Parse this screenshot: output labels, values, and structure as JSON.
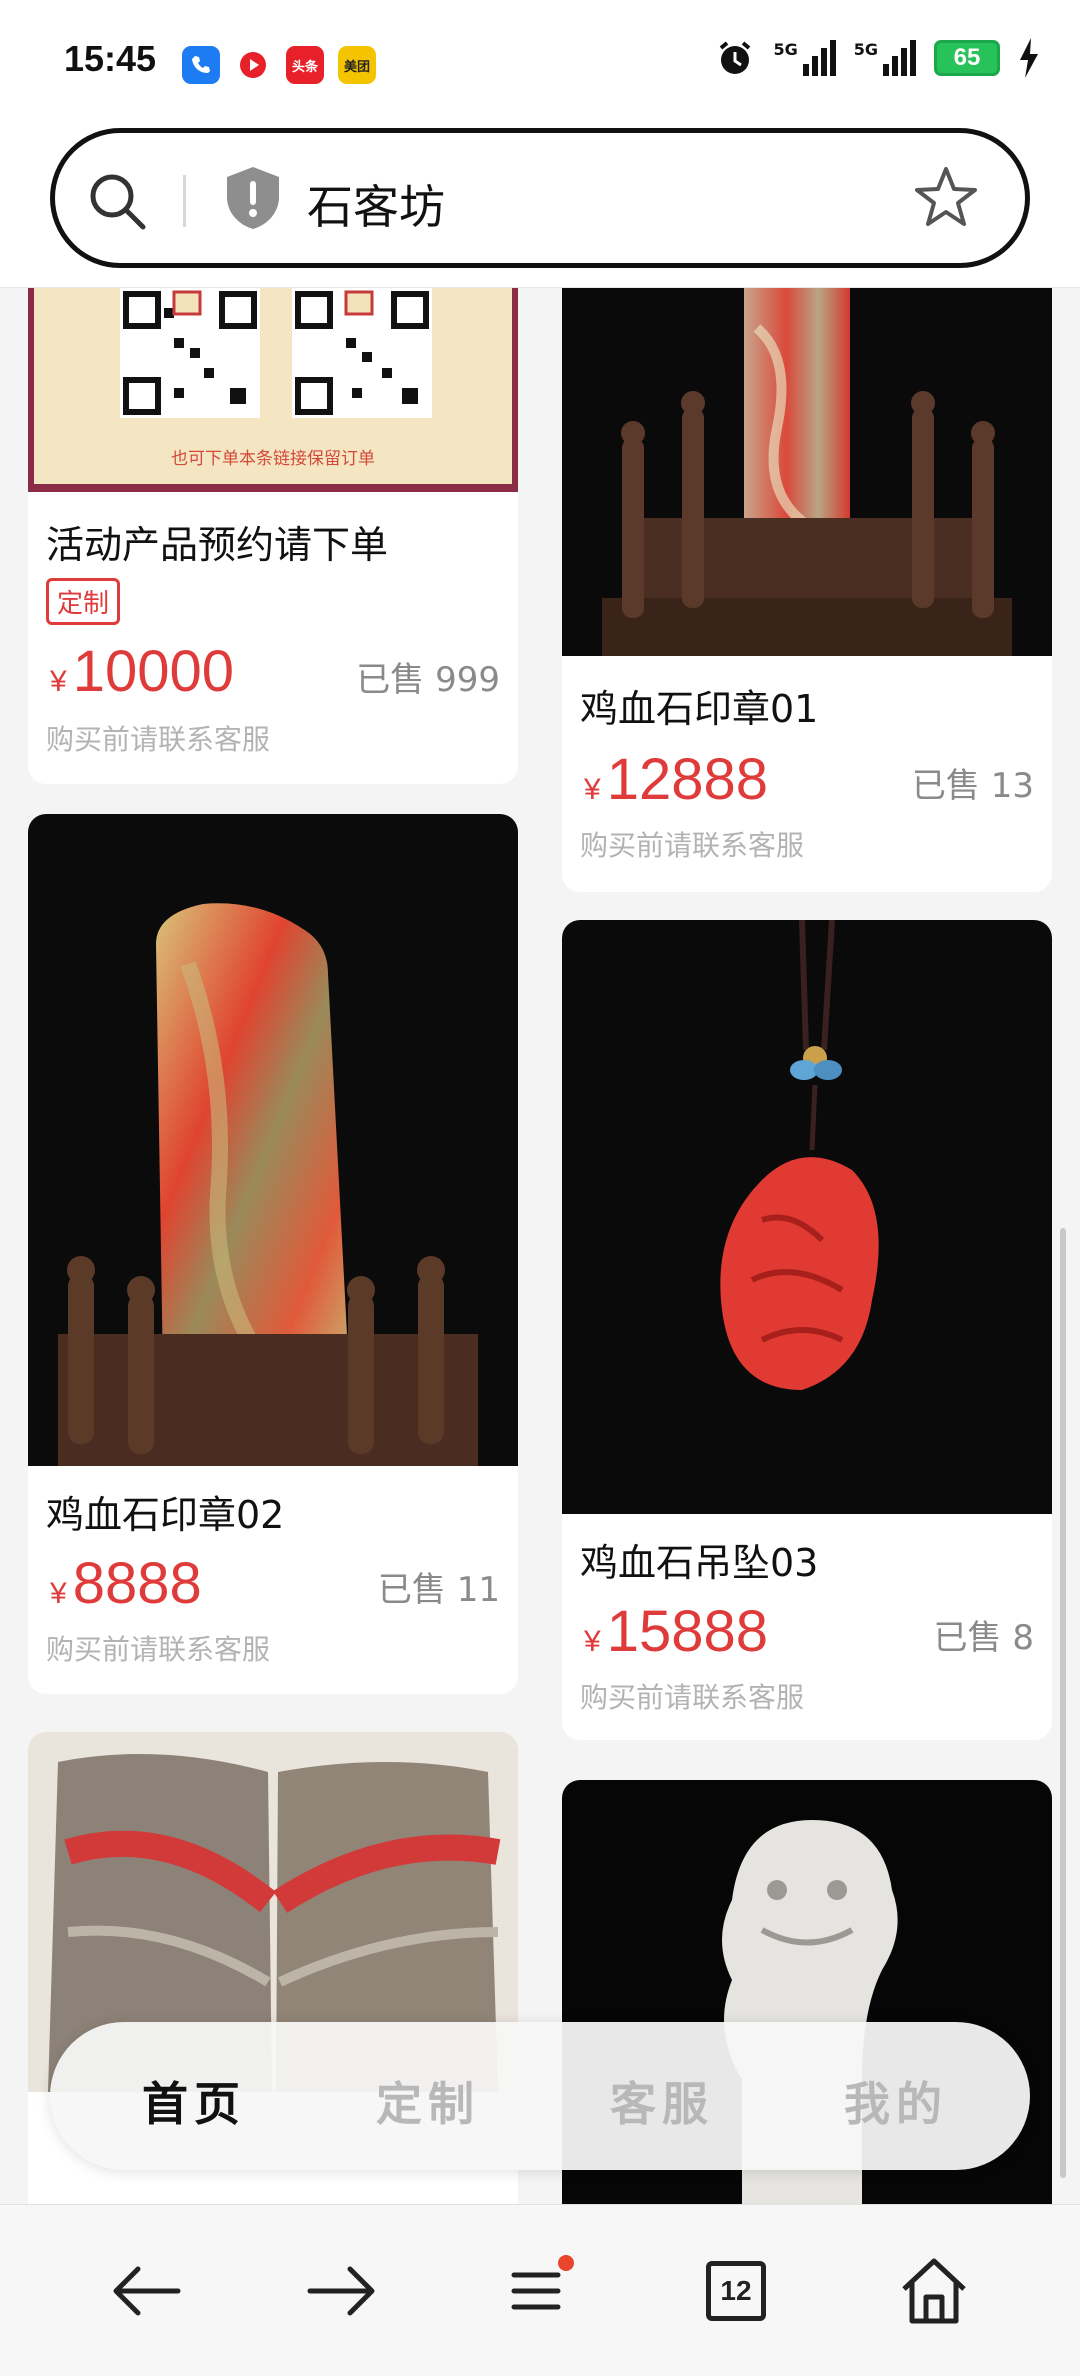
{
  "status": {
    "time": "15:45",
    "apps": [
      {
        "icon": "phone-app-icon",
        "label": "",
        "color": "#1e7cf2"
      },
      {
        "icon": "video-app-icon",
        "label": "",
        "color": "#e8202a"
      },
      {
        "icon": "toutiao-app-icon",
        "label": "头条",
        "color": "#e8202a"
      },
      {
        "icon": "meituan-app-icon",
        "label": "美团",
        "color": "#f5c400"
      }
    ],
    "signal_label_1": "5G",
    "signal_label_2": "5G",
    "battery": "65"
  },
  "search": {
    "query": "石客坊"
  },
  "products": [
    {
      "title": "活动产品预约请下单",
      "badge": "定制",
      "price_symbol": "¥",
      "price": "10000",
      "sold": "已售 999",
      "note": "购买前请联系客服",
      "qr_caption": "也可下单本条链接保留订单"
    },
    {
      "title": "鸡血石印章01",
      "price_symbol": "¥",
      "price": "12888",
      "sold": "已售 13",
      "note": "购买前请联系客服"
    },
    {
      "title": "鸡血石印章02",
      "price_symbol": "¥",
      "price": "8888",
      "sold": "已售 11",
      "note": "购买前请联系客服"
    },
    {
      "title": "鸡血石吊坠03",
      "price_symbol": "¥",
      "price": "15888",
      "sold": "已售 8",
      "note": "购买前请联系客服"
    },
    {
      "title": "",
      "price_symbol": "",
      "price": "",
      "sold": "",
      "note": ""
    },
    {
      "title": "",
      "price_symbol": "",
      "price": "",
      "sold": "",
      "note": ""
    }
  ],
  "tabs": [
    {
      "label": "首页",
      "active": true
    },
    {
      "label": "定制",
      "active": false
    },
    {
      "label": "客服",
      "active": false
    },
    {
      "label": "我的",
      "active": false
    }
  ],
  "browser_nav": {
    "tab_count": "12",
    "menu_has_notification": true,
    "accent_color": "#e8452c"
  },
  "colors": {
    "price_red": "#e03b3b",
    "badge_red": "#e03b3b"
  }
}
